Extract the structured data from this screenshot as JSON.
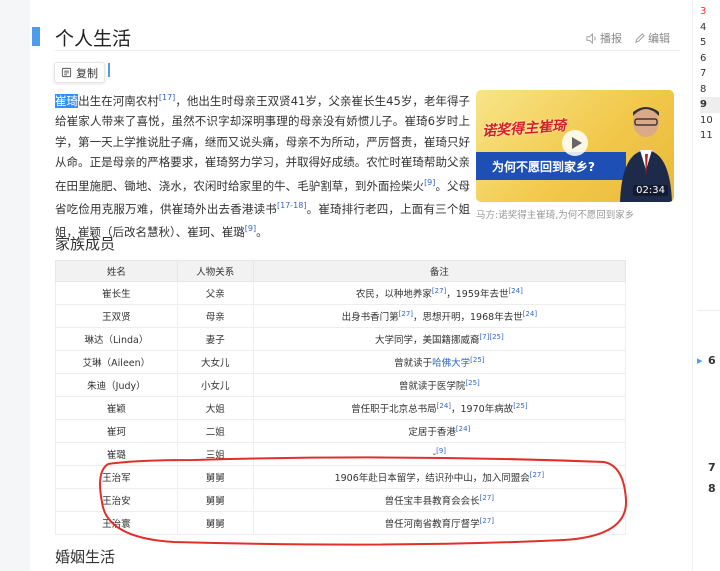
{
  "section": {
    "title": "个人生活",
    "actions": {
      "report": "播报",
      "edit": "编辑"
    }
  },
  "copy_button": {
    "label": "复制"
  },
  "paragraph": {
    "highlight": "崔琦",
    "text1": "出生在河南农村",
    "ref1": "[17]",
    "text2": "，他出生时母亲王双贤41岁，父亲崔长生45岁，老年得子给崔家人带来了喜悦，虽然不识字却深明事理的母亲没有娇惯儿子。崔琦6岁时上学，第一天上学推说肚子痛，继而又说头痛，母亲不为所动，严厉督责，崔琦只好从命。正是母亲的严格要求，崔琦努力学习，并取得好成绩。农忙时崔琦帮助父亲在田里施肥、锄地、浇水，农闲时给家里的牛、毛驴割草，到外面捡柴火",
    "ref2": "[9]",
    "text3": "。父母省吃俭用克服万难，供崔琦外出去香港读书",
    "ref3": "[17-18]",
    "text4": "。崔琦排行老四，上面有三个姐姐，崔颖（后改名慧秋）、崔珂、崔璐",
    "ref4": "[9]",
    "text5": "。"
  },
  "video": {
    "banner_top": "诺奖得主崔琦",
    "banner_bottom": "为何不愿回到家乡?",
    "duration": "02:34",
    "caption": "马方:诺奖得主崔琦,为何不愿回到家乡"
  },
  "family": {
    "title": "家族成员",
    "headers": [
      "姓名",
      "人物关系",
      "备注"
    ],
    "rows": [
      {
        "name": "崔长生",
        "relation": "父亲",
        "note": "农民，以种地养家",
        "ref1": "[27]",
        "note2": "，1959年去世",
        "ref2": "[24]"
      },
      {
        "name": "王双贤",
        "relation": "母亲",
        "note": "出身书香门第",
        "ref1": "[27]",
        "note2": "，思想开明，1968年去世",
        "ref2": "[24]"
      },
      {
        "name": "琳达（Linda）",
        "relation": "妻子",
        "note": "大学同学，美国籍挪威裔",
        "ref1": "[7]",
        "note2": "",
        "ref2": "[25]"
      },
      {
        "name": "艾琳（Aileen）",
        "relation": "大女儿",
        "note": "曾就读于",
        "link": "哈佛大学",
        "ref1": "[25]"
      },
      {
        "name": "朱迪（Judy）",
        "relation": "小女儿",
        "note": "曾就读于医学院",
        "ref1": "[25]"
      },
      {
        "name": "崔颖",
        "relation": "大姐",
        "note": "曾任职于北京总书局",
        "ref1": "[24]",
        "note2": "，1970年病故",
        "ref2": "[25]"
      },
      {
        "name": "崔珂",
        "relation": "二姐",
        "note": "定居于香港",
        "ref1": "[24]"
      },
      {
        "name": "崔璐",
        "relation": "三姐",
        "note": "-",
        "ref1": "[9]"
      },
      {
        "name": "王治军",
        "relation": "舅舅",
        "note": "1906年赴日本留学，结识孙中山，加入同盟会",
        "ref1": "[27]"
      },
      {
        "name": "王治安",
        "relation": "舅舅",
        "note": "曾任宝丰县教育会会长",
        "ref1": "[27]"
      },
      {
        "name": "王治寰",
        "relation": "舅舅",
        "note": "曾任河南省教育厅督学",
        "ref1": "[27]"
      }
    ]
  },
  "marriage": {
    "title": "婚姻生活"
  },
  "right_list": [
    "3",
    "4",
    "5",
    "6",
    "7",
    "8",
    "9",
    "10",
    "11"
  ],
  "right_extra": [
    "6",
    "7",
    "8"
  ],
  "colors": {
    "accent": "#4f9cee",
    "link": "#3366cc",
    "annotation": "#e0302a"
  }
}
